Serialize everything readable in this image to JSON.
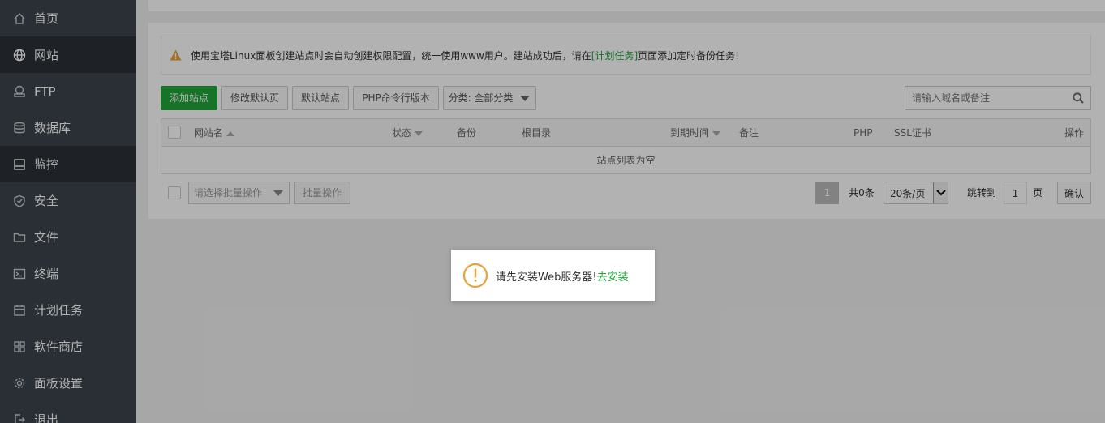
{
  "sidebar": {
    "items": [
      {
        "label": "首页",
        "icon": "home-icon"
      },
      {
        "label": "网站",
        "icon": "globe-icon",
        "active": true
      },
      {
        "label": "FTP",
        "icon": "ftp-icon"
      },
      {
        "label": "数据库",
        "icon": "database-icon"
      },
      {
        "label": "监控",
        "icon": "monitor-icon",
        "active": true
      },
      {
        "label": "安全",
        "icon": "shield-icon"
      },
      {
        "label": "文件",
        "icon": "folder-icon"
      },
      {
        "label": "终端",
        "icon": "terminal-icon"
      },
      {
        "label": "计划任务",
        "icon": "calendar-icon"
      },
      {
        "label": "软件商店",
        "icon": "grid-icon"
      },
      {
        "label": "面板设置",
        "icon": "gear-icon"
      },
      {
        "label": "退出",
        "icon": "logout-icon"
      }
    ]
  },
  "alert": {
    "text_before": "使用宝塔Linux面板创建站点时会自动创建权限配置，统一使用www用户。建站成功后，请在",
    "link": "[计划任务]",
    "text_after": "页面添加定时备份任务!"
  },
  "toolbar": {
    "add_site": "添加站点",
    "edit_default_page": "修改默认页",
    "default_site": "默认站点",
    "php_cli": "PHP命令行版本",
    "category": "分类: 全部分类",
    "search_placeholder": "请输入域名或备注"
  },
  "table": {
    "columns": [
      "网站名",
      "状态",
      "备份",
      "根目录",
      "到期时间",
      "备注",
      "PHP",
      "SSL证书",
      "操作"
    ],
    "empty_text": "站点列表为空"
  },
  "footer": {
    "batch_placeholder": "请选择批量操作",
    "batch_button": "批量操作",
    "current_page": "1",
    "total": "共0条",
    "per_page": "20条/页",
    "jump_to": "跳转到",
    "jump_value": "1",
    "page_unit": "页",
    "confirm": "确认"
  },
  "dialog": {
    "message": "请先安装Web服务器!",
    "link": "去安装"
  },
  "colors": {
    "sidebar_bg": "#3c444d",
    "accent_green": "#20a53a",
    "warning_orange": "#e8a23a"
  }
}
